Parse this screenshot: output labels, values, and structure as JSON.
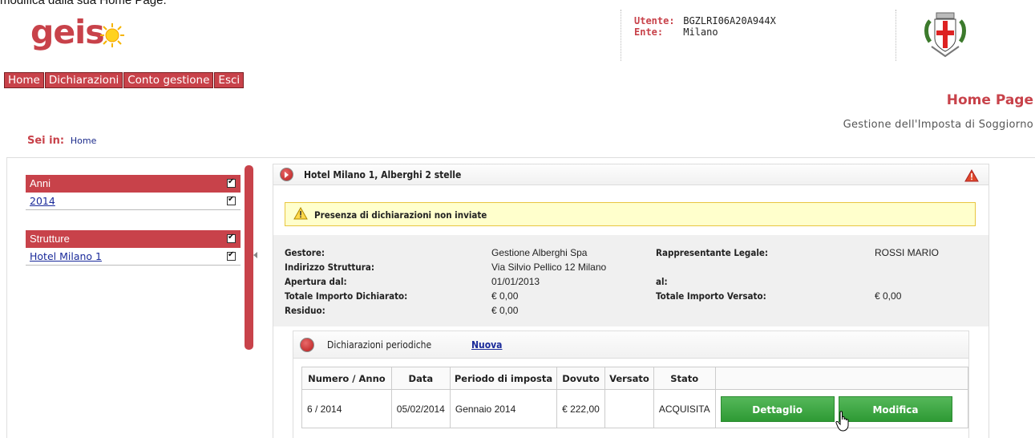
{
  "top_caption": "modifica dalla sua Home Page.",
  "logo": {
    "text": "geis"
  },
  "user": {
    "utente_label": "Utente:",
    "utente_value": "BGZLRI06A20A944X",
    "ente_label": "Ente:",
    "ente_value": "Milano"
  },
  "nav": {
    "items": [
      "Home",
      "Dichiarazioni",
      "Conto gestione",
      "Esci"
    ]
  },
  "page": {
    "title": "Home Page",
    "subtitle": "Gestione dell'Imposta di Soggiorno"
  },
  "breadcrumb": {
    "label": "Sei in:",
    "current": "Home"
  },
  "sidebar": {
    "panels": [
      {
        "header": "Anni",
        "items": [
          "2014"
        ]
      },
      {
        "header": "Strutture",
        "items": [
          "Hotel Milano 1"
        ]
      }
    ]
  },
  "main": {
    "title": "Hotel Milano 1, Alberghi 2 stelle",
    "alert": "Presenza di dichiarazioni non inviate",
    "info": {
      "gestore_label": "Gestore:",
      "gestore_value": "Gestione Alberghi Spa",
      "rappresentante_label": "Rappresentante Legale:",
      "rappresentante_value": "ROSSI MARIO",
      "indirizzo_label": "Indirizzo Struttura:",
      "indirizzo_value": "Via Silvio Pellico 12 Milano",
      "apertura_label": "Apertura dal:",
      "apertura_value": "01/01/2013",
      "al_label": "al:",
      "dichiarato_label": "Totale Importo Dichiarato:",
      "dichiarato_value": "€ 0,00",
      "versato_label": "Totale Importo Versato:",
      "versato_value": "€ 0,00",
      "residuo_label": "Residuo:",
      "residuo_value": "€ 0,00"
    },
    "declarations": {
      "title": "Dichiarazioni periodiche",
      "new_link": "Nuova",
      "columns": [
        "Numero / Anno",
        "Data",
        "Periodo di imposta",
        "Dovuto",
        "Versato",
        "Stato"
      ],
      "rows": [
        {
          "numero": "6 / 2014",
          "data": "05/02/2014",
          "periodo": "Gennaio 2014",
          "dovuto": "€ 222,00",
          "versato": "",
          "stato": "ACQUISITA",
          "btn_detail": "Dettaglio",
          "btn_edit": "Modifica"
        }
      ]
    }
  },
  "colors": {
    "brand_red": "#c8424a",
    "button_green": "#3aa63f",
    "alert_bg": "#ffffcc"
  }
}
